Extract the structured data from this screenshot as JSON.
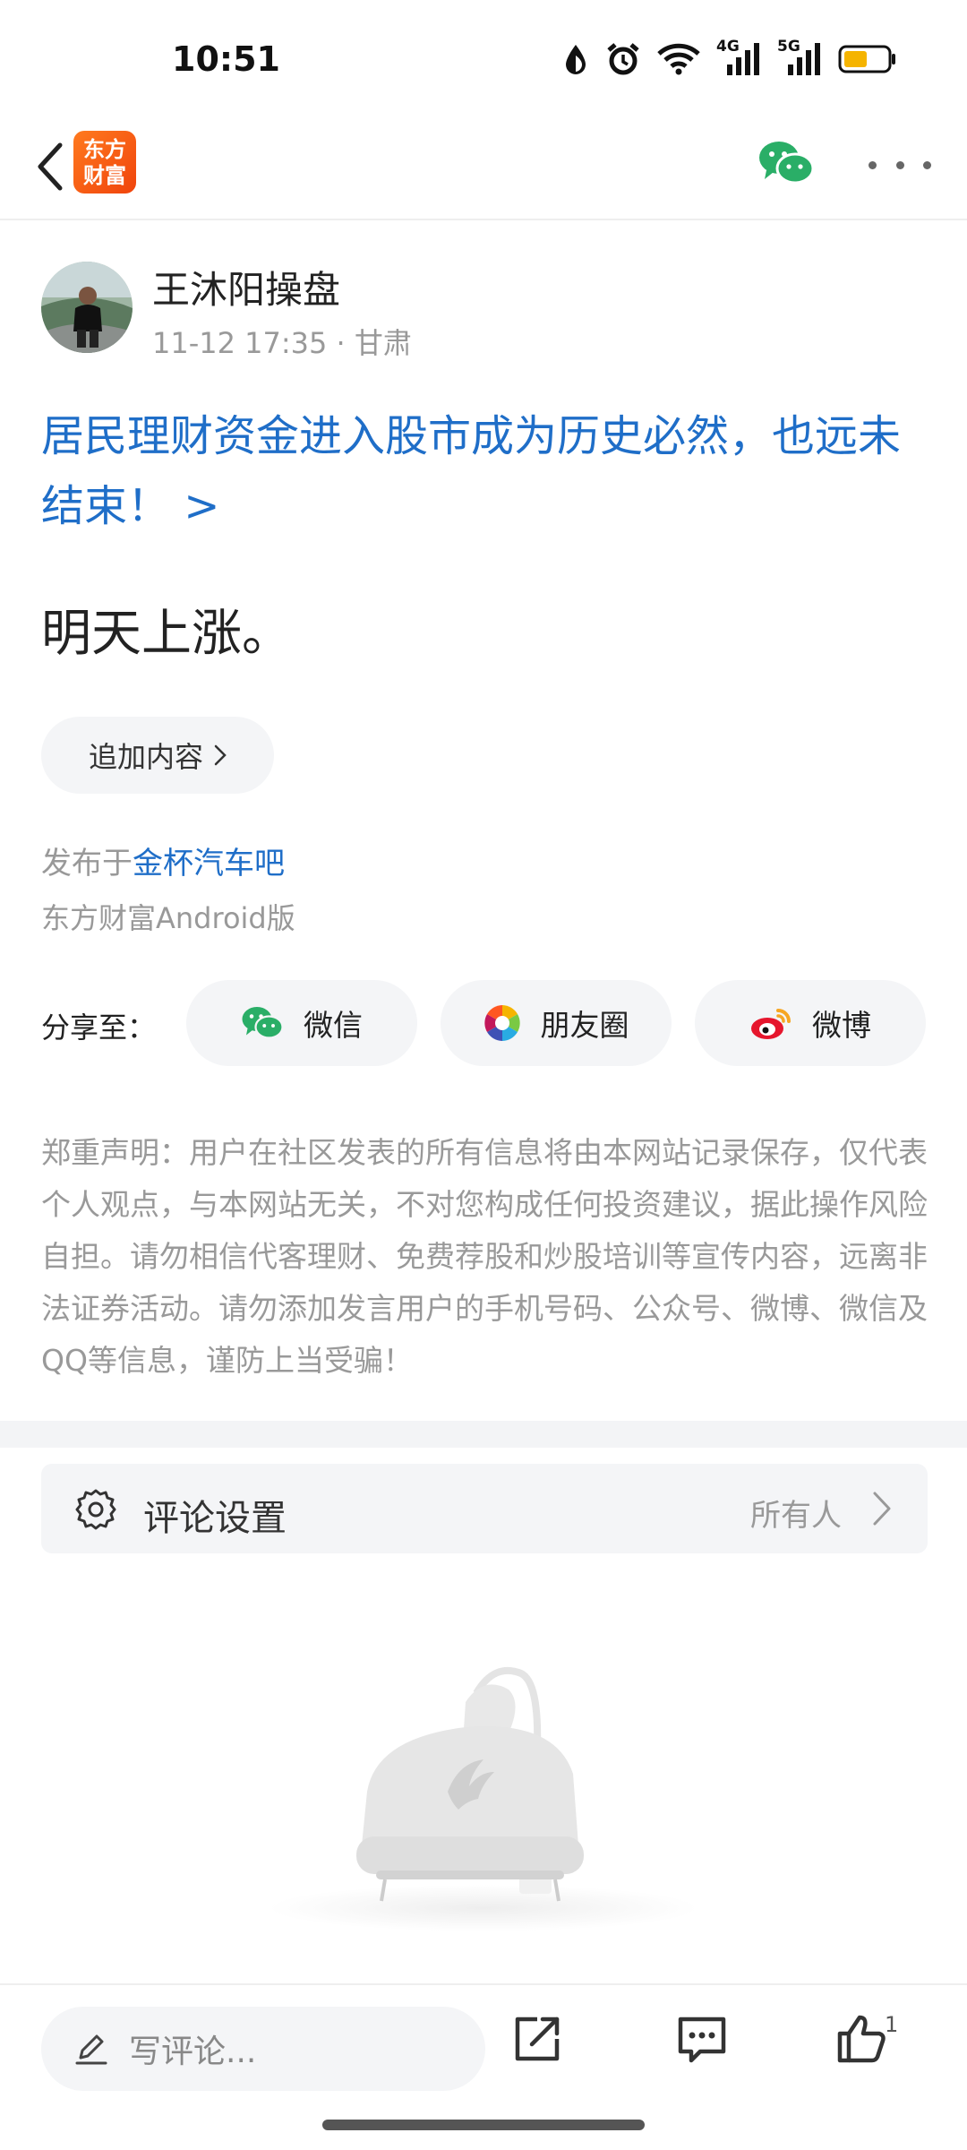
{
  "status_bar": {
    "time": "10:51",
    "network_1": "4G",
    "network_2": "5G",
    "battery_level": 0.55
  },
  "nav": {
    "logo_text_line1": "东方",
    "logo_text_line2": "财富"
  },
  "post": {
    "author_name": "王沐阳操盘",
    "timestamp": "11-12 17:35",
    "location": "· 甘肃",
    "title": "居民理财资金进入股市成为历史必然，也远未结束！ >",
    "body": "明天上涨。",
    "append_label": "追加内容",
    "published_prefix": "发布于",
    "published_bar": "金杯汽车吧",
    "client_version": "东方财富Android版"
  },
  "share": {
    "label": "分享至：",
    "wechat": "微信",
    "moments": "朋友圈",
    "weibo": "微博"
  },
  "disclaimer": "郑重声明：用户在社区发表的所有信息将由本网站记录保存，仅代表个人观点，与本网站无关，不对您构成任何投资建议，据此操作风险自担。请勿相信代客理财、免费荐股和炒股培训等宣传内容，远离非法证券活动。请勿添加发言用户的手机号码、公众号、微博、微信及QQ等信息，谨防上当受骗！",
  "comment_settings": {
    "label": "评论设置",
    "value": "所有人"
  },
  "bottom_bar": {
    "comment_placeholder": "写评论...",
    "like_count": "1"
  },
  "colors": {
    "link_blue": "#1f6ec8",
    "brand_orange": "#f0440c",
    "wechat_green": "#2aae67",
    "weibo_red": "#e6162d"
  }
}
